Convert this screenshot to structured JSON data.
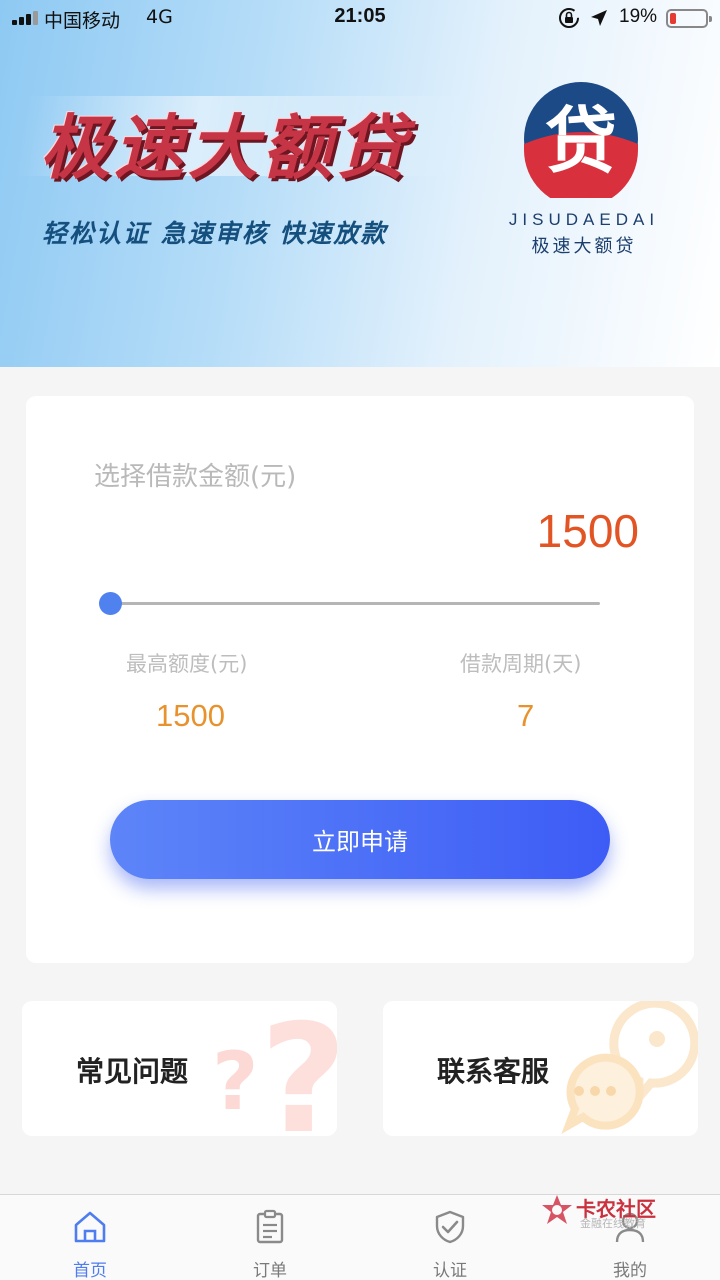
{
  "status_bar": {
    "carrier": "中国移动",
    "network": "4G",
    "time": "21:05",
    "battery_percent": "19%",
    "battery_level": 0.19,
    "battery_color": "#e53b30"
  },
  "banner": {
    "title": "极速大额贷",
    "slogan": "轻松认证 急速审核 快速放款",
    "logo_pinyin": "JISUDAEDAI",
    "logo_name": "极速大额贷",
    "logo_glyph": "贷",
    "title_color": "#c53545"
  },
  "loan": {
    "amount_label": "选择借款金额(元)",
    "amount": "1500",
    "slider_fraction": 0,
    "max_limit_label": "最高额度(元)",
    "max_limit": "1500",
    "term_label": "借款周期(天)",
    "term": "7",
    "apply_label": "立即申请",
    "accent_color": "#4f81ef",
    "amount_color": "#e35424"
  },
  "quick_links": {
    "faq_label": "常见问题",
    "service_label": "联系客服"
  },
  "watermark": {
    "title": "卡农社区",
    "subtitle": "金融在线教育"
  },
  "tabs": [
    {
      "label": "首页",
      "icon": "home-icon",
      "active": true
    },
    {
      "label": "订单",
      "icon": "order-icon",
      "active": false
    },
    {
      "label": "认证",
      "icon": "shield-check-icon",
      "active": false
    },
    {
      "label": "我的",
      "icon": "user-icon",
      "active": false
    }
  ],
  "colors": {
    "tab_active": "#4f7df0",
    "tab_inactive": "#7a7a7a",
    "stat_value": "#e8922e"
  }
}
